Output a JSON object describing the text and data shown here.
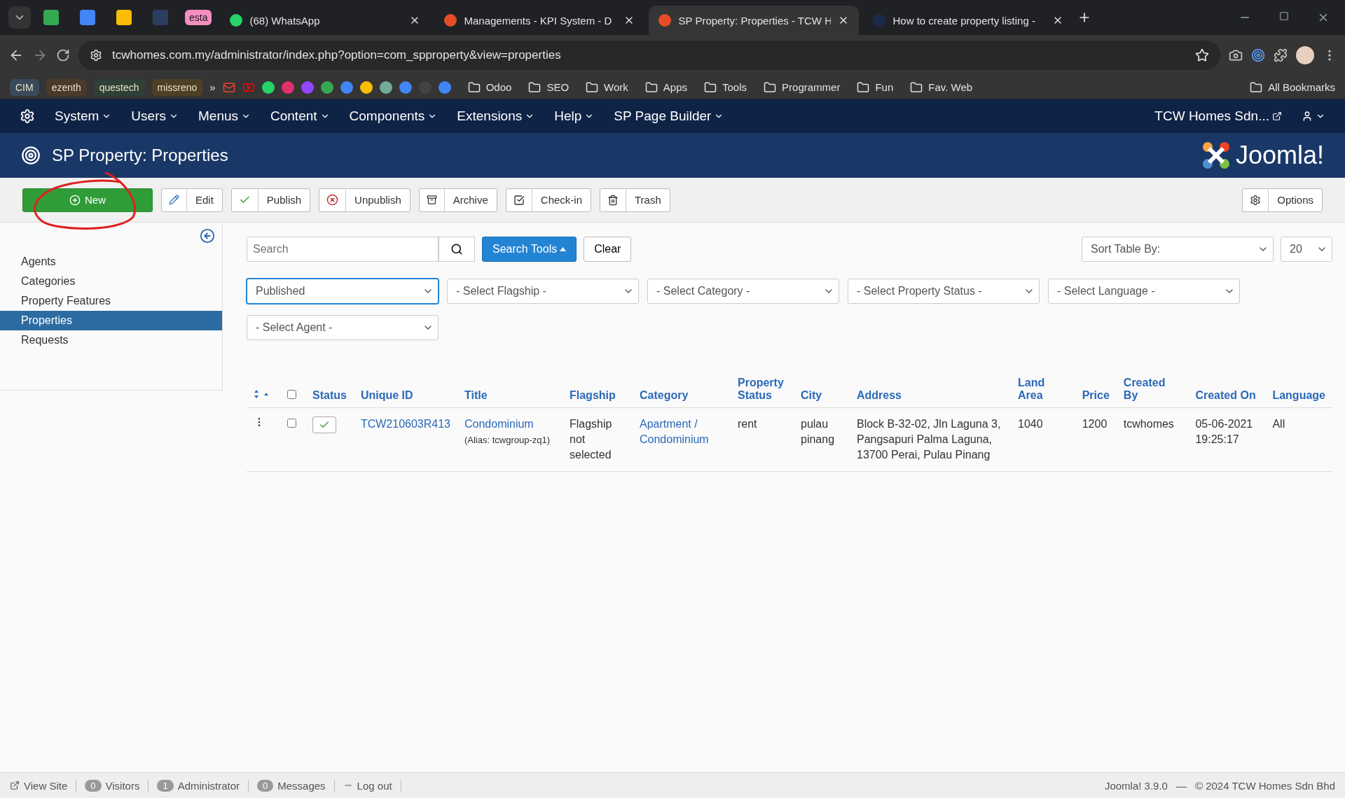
{
  "browser": {
    "pinned_badge": "esta",
    "tabs": [
      {
        "title": "(68) WhatsApp",
        "selected": false
      },
      {
        "title": "Managements - KPI System - D",
        "selected": false
      },
      {
        "title": "SP Property: Properties - TCW H",
        "selected": true
      },
      {
        "title": "How to create property listing -",
        "selected": false
      }
    ],
    "url": "tcwhomes.com.my/administrator/index.php?option=com_spproperty&view=properties",
    "bookmark_chips": [
      {
        "label": "CIM",
        "color": "#3a4a5a"
      },
      {
        "label": "ezenth",
        "color": "#4a3a2a"
      },
      {
        "label": "questech",
        "color": "#2f4036"
      },
      {
        "label": "missreno",
        "color": "#4d4024"
      }
    ],
    "overflow": "»",
    "folders": [
      "Odoo",
      "SEO",
      "Work",
      "Apps",
      "Tools",
      "Programmer",
      "Fun",
      "Fav. Web"
    ],
    "all_bookmarks": "All Bookmarks"
  },
  "admin_nav": {
    "menus": [
      "System",
      "Users",
      "Menus",
      "Content",
      "Components",
      "Extensions",
      "Help",
      "SP Page Builder"
    ],
    "site_link": "TCW Homes Sdn..."
  },
  "header": {
    "title": "SP Property: Properties",
    "logo": "Joomla!"
  },
  "toolbar": {
    "buttons": [
      {
        "label": "New",
        "kind": "new"
      },
      {
        "label": "Edit",
        "kind": "edit"
      },
      {
        "label": "Publish",
        "kind": "publish"
      },
      {
        "label": "Unpublish",
        "kind": "unpublish"
      },
      {
        "label": "Archive",
        "kind": "archive"
      },
      {
        "label": "Check-in",
        "kind": "checkin"
      },
      {
        "label": "Trash",
        "kind": "trash"
      }
    ],
    "options": "Options"
  },
  "sidebar": {
    "items": [
      {
        "label": "Agents",
        "selected": false
      },
      {
        "label": "Categories",
        "selected": false
      },
      {
        "label": "Property Features",
        "selected": false
      },
      {
        "label": "Properties",
        "selected": true
      },
      {
        "label": "Requests",
        "selected": false
      }
    ]
  },
  "filters": {
    "search": {
      "placeholder": "Search"
    },
    "search_tools": "Search Tools",
    "clear": "Clear",
    "sort": "Sort Table By:",
    "limit": "20",
    "selects": [
      {
        "value": "Published",
        "active": true
      },
      {
        "value": "- Select Flagship -",
        "active": false
      },
      {
        "value": "- Select Category -",
        "active": false
      },
      {
        "value": "- Select Property Status -",
        "active": false
      },
      {
        "value": "- Select Language -",
        "active": false
      },
      {
        "value": "- Select Agent -",
        "active": false
      }
    ]
  },
  "table": {
    "select_all_checked": false,
    "columns": [
      "Status",
      "Unique ID",
      "Title",
      "Flagship",
      "Category",
      "Property Status",
      "City",
      "Address",
      "Land Area",
      "Price",
      "Created By",
      "Created On",
      "Language"
    ],
    "rows": [
      {
        "checked": false,
        "published": true,
        "unique_id": "TCW210603R413",
        "title": "Condominium",
        "alias": "(Alias: tcwgroup-zq1)",
        "flagship": "Flagship not selected",
        "category": "Apartment / Condominium",
        "property_status": "rent",
        "city": "pulau pinang",
        "address": "Block B-32-02, Jln Laguna 3, Pangsapuri Palma Laguna, 13700 Perai, Pulau Pinang",
        "land_area": "1040",
        "price": "1200",
        "created_by": "tcwhomes",
        "created_on": "05-06-2021 19:25:17",
        "language": "All"
      }
    ]
  },
  "status_bar": {
    "items": [
      {
        "label": "View Site",
        "kind": "link"
      },
      {
        "label": "Visitors",
        "kind": "count",
        "count": "0"
      },
      {
        "label": "Administrator",
        "kind": "count",
        "count": "1"
      },
      {
        "label": "Messages",
        "kind": "count",
        "count": "0"
      },
      {
        "label": "Log out",
        "kind": "logout"
      }
    ],
    "version": "Joomla! 3.9.0",
    "separator": "—",
    "copyright": "© 2024 TCW Homes Sdn Bhd"
  }
}
